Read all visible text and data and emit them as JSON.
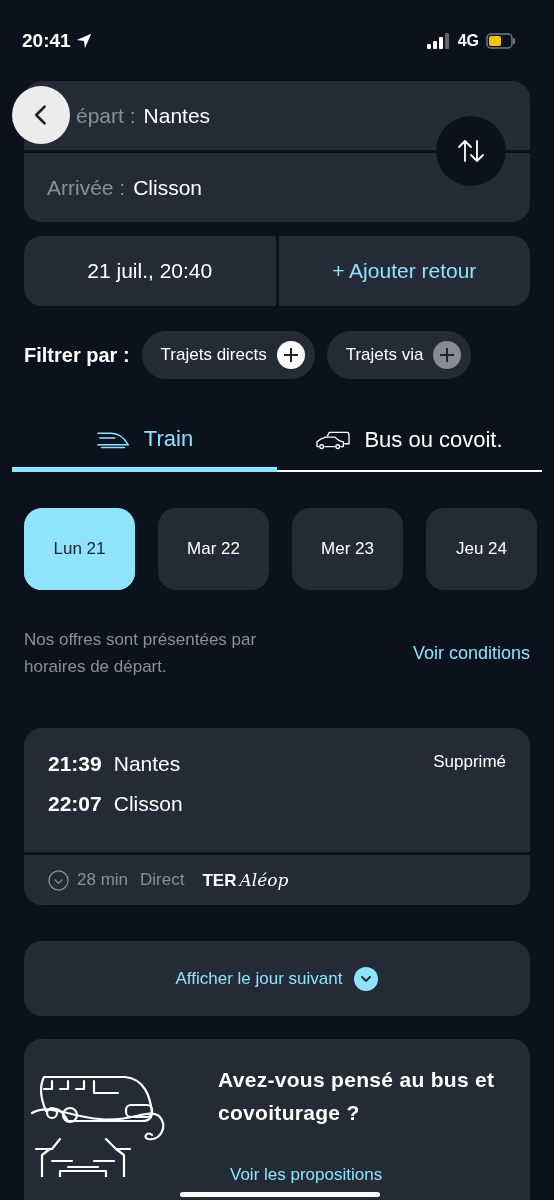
{
  "status_bar": {
    "time": "20:41",
    "network": "4G"
  },
  "route": {
    "from_label": "épart :",
    "from_value": "Nantes",
    "to_label": "Arrivée :",
    "to_value": "Clisson"
  },
  "date_bar": {
    "date": "21 juil., 20:40",
    "return_action": "+ Ajouter retour"
  },
  "filters": {
    "label": "Filtrer par :",
    "chips": [
      {
        "label": "Trajets directs"
      },
      {
        "label": "Trajets via"
      }
    ]
  },
  "tabs": [
    {
      "label": "Train",
      "kind": "train",
      "selected": true
    },
    {
      "label": "Bus ou covoit.",
      "kind": "bus",
      "selected": false
    }
  ],
  "days": [
    {
      "label": "Lun 21",
      "selected": true
    },
    {
      "label": "Mar 22",
      "selected": false
    },
    {
      "label": "Mer 23",
      "selected": false
    },
    {
      "label": "Jeu 24",
      "selected": false
    }
  ],
  "notice": {
    "text": "Nos offres sont présentées par horaires de départ.",
    "link": "Voir conditions"
  },
  "journeys": [
    {
      "departure_time": "21:39",
      "departure_station": "Nantes",
      "arrival_time": "22:07",
      "arrival_station": "Clisson",
      "status": "Supprimé",
      "duration": "28 min",
      "type": "Direct",
      "operator": "TER",
      "brand": "Aléop"
    }
  ],
  "next_day": {
    "label": "Afficher le jour suivant"
  },
  "promo": {
    "title": "Avez-vous pensé au bus et covoiturage ?",
    "link": "Voir les propositions"
  }
}
